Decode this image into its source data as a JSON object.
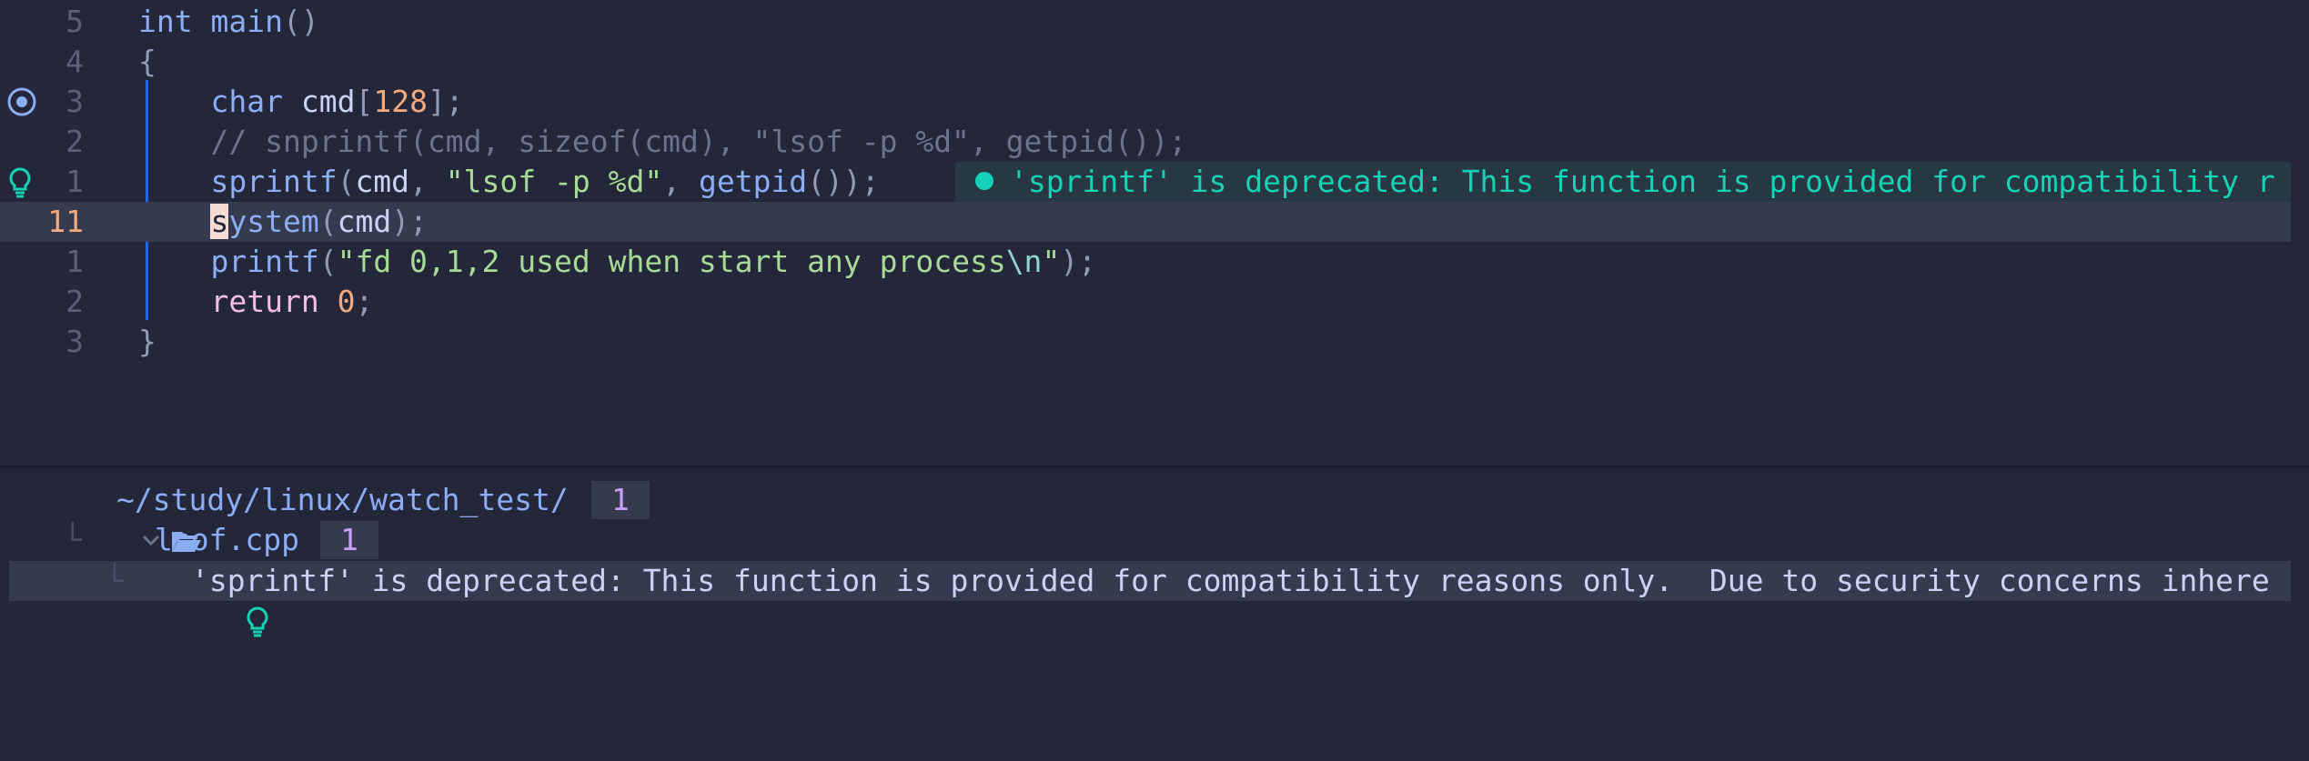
{
  "editor": {
    "lines": [
      {
        "num": "5",
        "tokens": [
          {
            "t": "int",
            "c": "kw-type"
          },
          {
            "t": " ",
            "c": "plain"
          },
          {
            "t": "main",
            "c": "fn"
          },
          {
            "t": "()",
            "c": "pun"
          }
        ]
      },
      {
        "num": "4",
        "tokens": [
          {
            "t": "{",
            "c": "pun"
          }
        ]
      },
      {
        "num": "3",
        "tokens": [
          {
            "t": "    ",
            "c": "plain"
          },
          {
            "t": "char",
            "c": "kw-type"
          },
          {
            "t": " cmd",
            "c": "plain"
          },
          {
            "t": "[",
            "c": "pun"
          },
          {
            "t": "128",
            "c": "num"
          },
          {
            "t": "];",
            "c": "pun"
          }
        ]
      },
      {
        "num": "2",
        "tokens": [
          {
            "t": "    ",
            "c": "plain"
          },
          {
            "t": "// snprintf(cmd, sizeof(cmd), \"lsof -p %d\", getpid());",
            "c": "comment"
          }
        ]
      },
      {
        "num": "1",
        "tokens": [
          {
            "t": "    ",
            "c": "plain"
          },
          {
            "t": "sprintf",
            "c": "fn"
          },
          {
            "t": "(",
            "c": "pun"
          },
          {
            "t": "cmd",
            "c": "plain"
          },
          {
            "t": ", ",
            "c": "pun"
          },
          {
            "t": "\"lsof -p %d\"",
            "c": "str"
          },
          {
            "t": ", ",
            "c": "pun"
          },
          {
            "t": "getpid",
            "c": "fn"
          },
          {
            "t": "());",
            "c": "pun"
          }
        ]
      },
      {
        "num": "11",
        "tokens": [
          {
            "t": "    ",
            "c": "plain"
          },
          {
            "t": "s",
            "c": "cursor"
          },
          {
            "t": "ystem",
            "c": "fn"
          },
          {
            "t": "(",
            "c": "pun"
          },
          {
            "t": "cmd",
            "c": "plain"
          },
          {
            "t": ");",
            "c": "pun"
          }
        ]
      },
      {
        "num": "1",
        "tokens": [
          {
            "t": "    ",
            "c": "plain"
          },
          {
            "t": "printf",
            "c": "fn"
          },
          {
            "t": "(",
            "c": "pun"
          },
          {
            "t": "\"fd 0,1,2 used when start any process",
            "c": "str"
          },
          {
            "t": "\\n",
            "c": "esc"
          },
          {
            "t": "\"",
            "c": "str"
          },
          {
            "t": ");",
            "c": "pun"
          }
        ]
      },
      {
        "num": "2",
        "tokens": [
          {
            "t": "    ",
            "c": "plain"
          },
          {
            "t": "return",
            "c": "kw-ret"
          },
          {
            "t": " ",
            "c": "plain"
          },
          {
            "t": "0",
            "c": "num"
          },
          {
            "t": ";",
            "c": "pun"
          }
        ]
      },
      {
        "num": "3",
        "tokens": [
          {
            "t": "}",
            "c": "pun"
          }
        ]
      }
    ],
    "virtual_text": "'sprintf' is deprecated: This function is provided for compatibility r"
  },
  "diagnostics": {
    "dir": "~/study/linux/watch_test/",
    "dir_count": "1",
    "file": "lsof.cpp",
    "file_count": "1",
    "message": "'sprintf' is deprecated: This function is provided for compatibility reasons only.  Due to security concerns inhere"
  },
  "colors": {
    "background": "#24273a",
    "cursorline": "#363a4f",
    "diagnostic_hint": "#13d2b7",
    "line_nr_current": "#f5a97f"
  },
  "icons": {
    "breakpoint": "breakpoint-icon",
    "hint": "lightbulb-icon",
    "folder": "folder-open-icon",
    "cpp": "cpp-file-icon",
    "chevron": "chevron-down-icon"
  }
}
